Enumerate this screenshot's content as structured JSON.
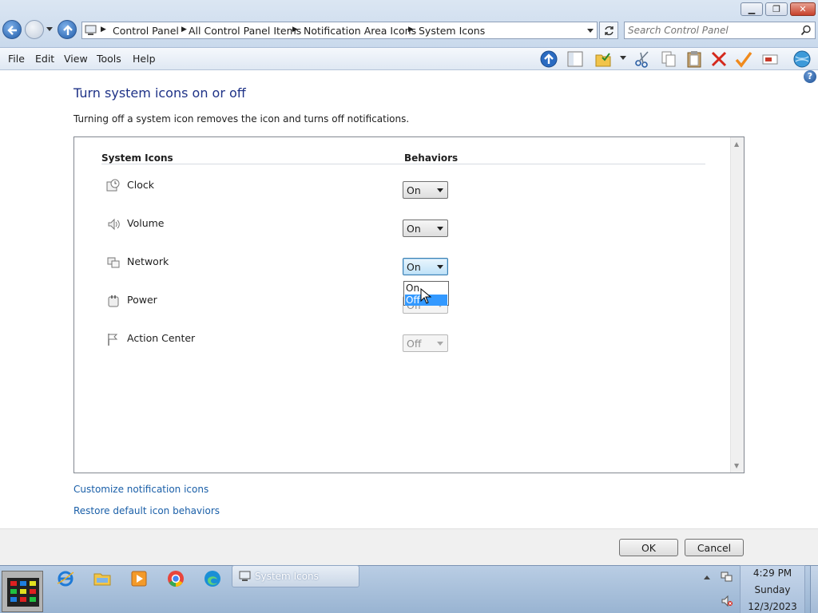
{
  "window": {
    "minimize_glyph": "▁",
    "maximize_glyph": "❐",
    "close_glyph": "✕"
  },
  "address": {
    "crumbs": [
      "Control Panel",
      "All Control Panel Items",
      "Notification Area Icons",
      "System Icons"
    ]
  },
  "search": {
    "placeholder": "Search Control Panel"
  },
  "menu": {
    "file": "File",
    "edit": "Edit",
    "view": "View",
    "tools": "Tools",
    "help": "Help"
  },
  "help_glyph": "?",
  "page": {
    "title": "Turn system icons on or off",
    "description": "Turning off a system icon removes the icon and turns off notifications."
  },
  "table": {
    "col_icons": "System Icons",
    "col_behaviors": "Behaviors",
    "rows": [
      {
        "label": "Clock",
        "value": "On",
        "icon": "clock-icon",
        "enabled": true
      },
      {
        "label": "Volume",
        "value": "On",
        "icon": "volume-icon",
        "enabled": true
      },
      {
        "label": "Network",
        "value": "On",
        "icon": "network-icon",
        "enabled": true
      },
      {
        "label": "Power",
        "value": "Off",
        "icon": "power-icon",
        "enabled": false
      },
      {
        "label": "Action Center",
        "value": "Off",
        "icon": "flag-icon",
        "enabled": false
      }
    ],
    "dropdown_options": [
      "On",
      "Off"
    ],
    "dropdown_highlighted": "Off"
  },
  "links": {
    "customize": "Customize notification icons",
    "restore": "Restore default icon behaviors"
  },
  "buttons": {
    "ok": "OK",
    "cancel": "Cancel"
  },
  "taskbar": {
    "task_label": "System Icons",
    "time": "4:29 PM",
    "day": "Sunday",
    "date": "12/3/2023"
  },
  "colors": {
    "title_blue": "#1e3287",
    "link_blue": "#1a5fa8",
    "selection_blue": "#3399ff"
  }
}
